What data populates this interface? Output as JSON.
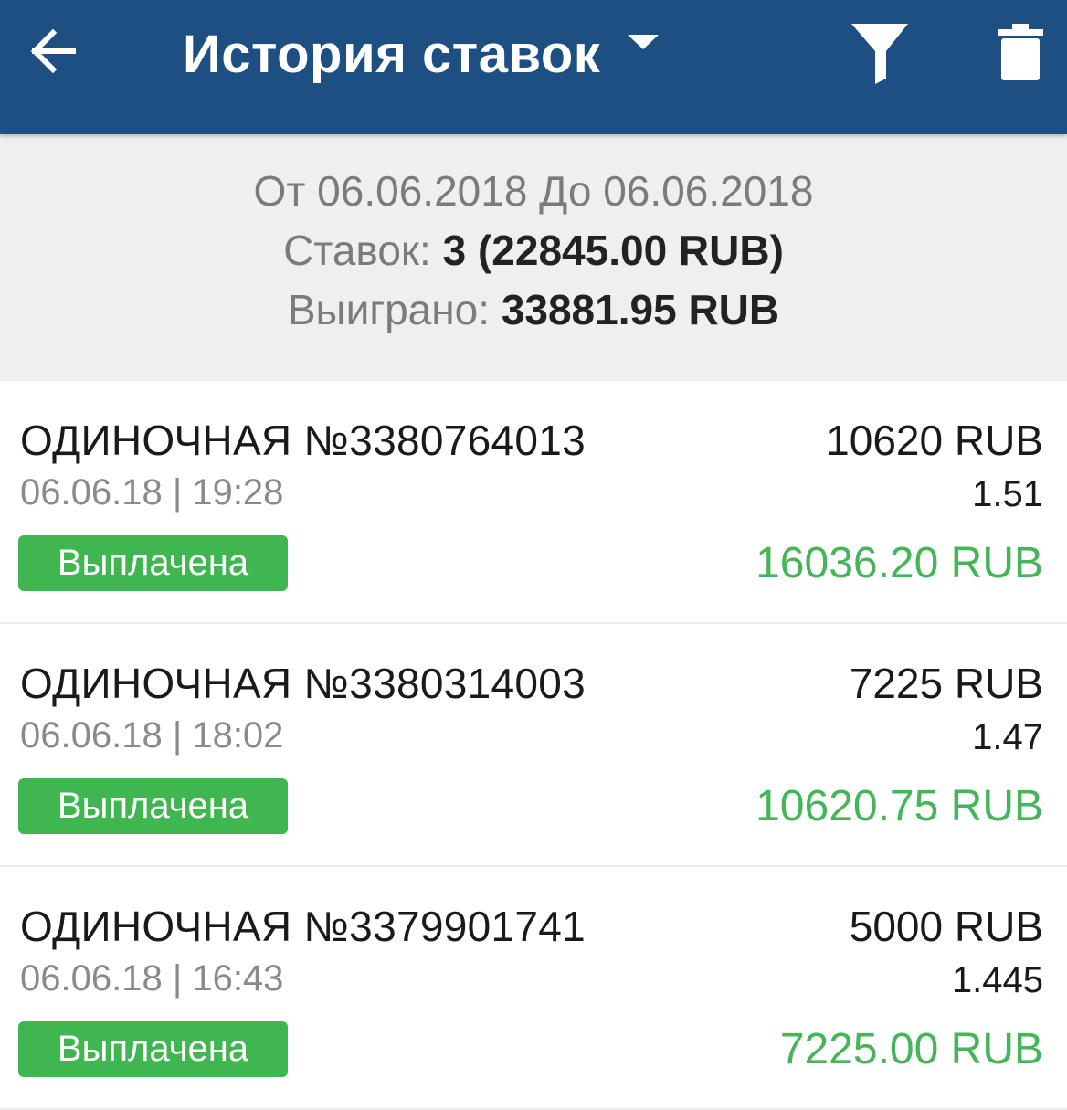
{
  "appbar": {
    "title": "История ставок",
    "back_icon": "arrow-left-icon",
    "dropdown_icon": "caret-down-icon",
    "filter_icon": "filter-icon",
    "delete_icon": "trash-icon"
  },
  "summary": {
    "period": "От 06.06.2018 До 06.06.2018",
    "bets_label": "Ставок:",
    "bets_value": "3 (22845.00 RUB)",
    "won_label": "Выиграно:",
    "won_value": "33881.95 RUB"
  },
  "colors": {
    "appbar": "#1e4f82",
    "status_green": "#3fb650",
    "win_green": "#44b558"
  },
  "bets": [
    {
      "name": "ОДИНОЧНАЯ №3380764013",
      "datetime": "06.06.18 | 19:28",
      "status": "Выплачена",
      "stake": "10620 RUB",
      "coef": "1.51",
      "win": "16036.20 RUB"
    },
    {
      "name": "ОДИНОЧНАЯ №3380314003",
      "datetime": "06.06.18 | 18:02",
      "status": "Выплачена",
      "stake": "7225 RUB",
      "coef": "1.47",
      "win": "10620.75 RUB"
    },
    {
      "name": "ОДИНОЧНАЯ №3379901741",
      "datetime": "06.06.18 | 16:43",
      "status": "Выплачена",
      "stake": "5000 RUB",
      "coef": "1.445",
      "win": "7225.00 RUB"
    }
  ]
}
